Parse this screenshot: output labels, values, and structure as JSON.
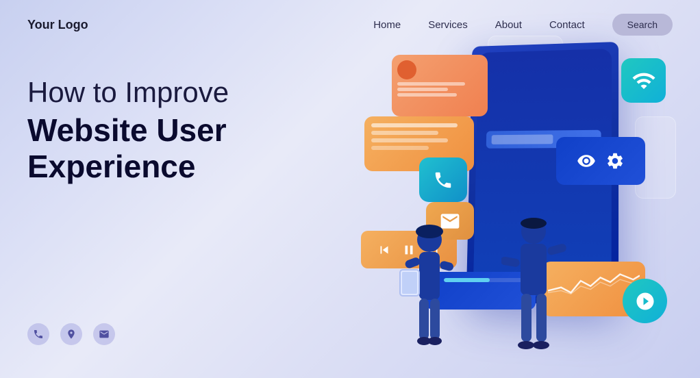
{
  "header": {
    "logo": "Your Logo",
    "nav": {
      "items": [
        {
          "label": "Home",
          "id": "home"
        },
        {
          "label": "Services",
          "id": "services"
        },
        {
          "label": "About",
          "id": "about"
        },
        {
          "label": "Contact",
          "id": "contact"
        }
      ],
      "search_btn": "Search"
    }
  },
  "hero": {
    "title_line1": "How to Improve",
    "title_line2": "Website User",
    "title_line3": "Experience"
  },
  "contact_icons": {
    "phone": "phone-icon",
    "location": "location-icon",
    "email": "email-icon"
  },
  "colors": {
    "bg_from": "#c8d0f0",
    "bg_to": "#e8eaf8",
    "accent_blue": "#1040c0",
    "accent_teal": "#20c0c0",
    "accent_orange": "#f5a050",
    "text_dark": "#0a0a2e",
    "nav_search_bg": "#b8b8d8"
  }
}
